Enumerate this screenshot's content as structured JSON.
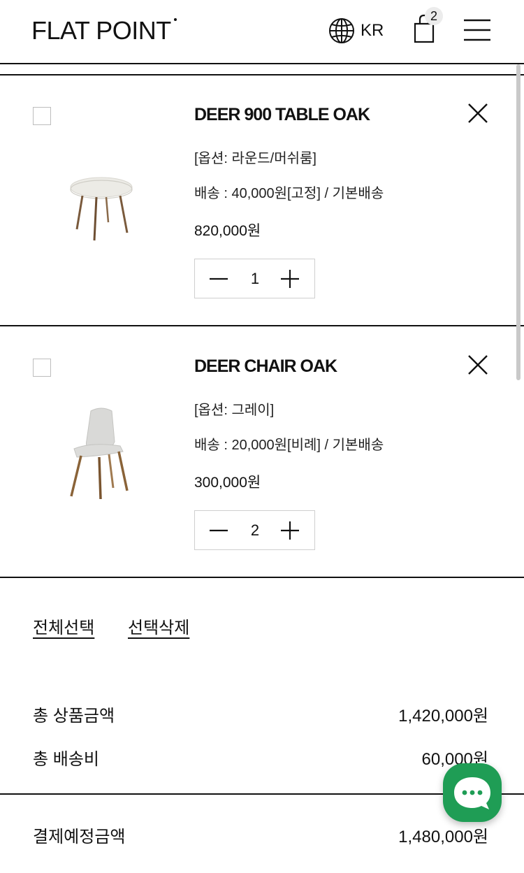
{
  "header": {
    "logo": "FLAT POINT",
    "language": "KR",
    "cart_count": "2",
    "icons": [
      "globe-icon",
      "shopping-bag-icon",
      "hamburger-menu-icon"
    ]
  },
  "items": [
    {
      "name": "DEER 900 TABLE OAK",
      "option": "[옵션: 라운드/머쉬룸]",
      "shipping": "배송 : 40,000원[고정] / 기본배송",
      "price": "820,000원",
      "quantity": "1",
      "image": "round-table-image"
    },
    {
      "name": "DEER CHAIR OAK",
      "option": "[옵션: 그레이]",
      "shipping": "배송 : 20,000원[비례] / 기본배송",
      "price": "300,000원",
      "quantity": "2",
      "image": "chair-image"
    }
  ],
  "actions": {
    "select_all": "전체선택",
    "delete_selected": "선택삭제"
  },
  "summary": {
    "product_total_label": "총 상품금액",
    "product_total_value": "1,420,000원",
    "shipping_total_label": "총 배송비",
    "shipping_total_value": "60,000원",
    "payment_label": "결제예정금액",
    "payment_value": "1,480,000원"
  },
  "colors": {
    "chat_button": "#1f9d55",
    "divider": "#111111",
    "checkbox_border": "#bdbdbd"
  }
}
